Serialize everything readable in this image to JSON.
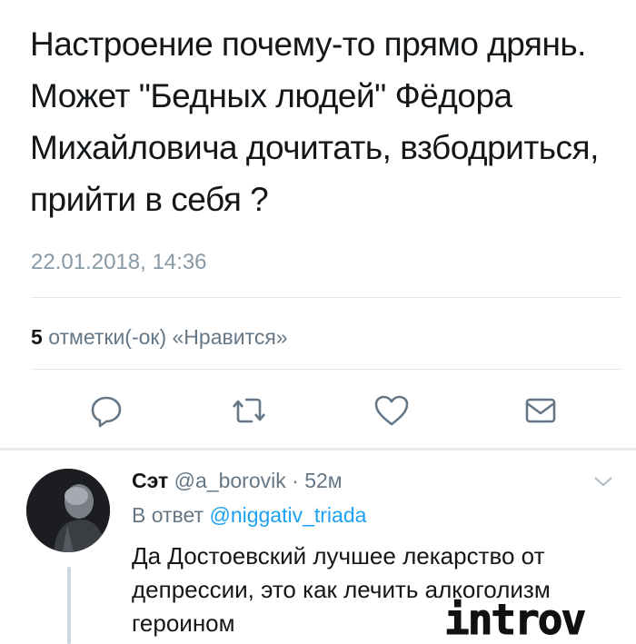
{
  "tweet": {
    "text": "Настроение почему-то прямо дрянь. Может \"Бедных людей\" Фёдора Михайловича дочитать, взбодриться, прийти в себя ?",
    "timestamp": "22.01.2018, 14:36",
    "likes_count": "5",
    "likes_label": "отметки(-ок) «Нравится»"
  },
  "actions": [
    "reply-icon",
    "retweet-icon",
    "like-icon",
    "message-icon"
  ],
  "reply": {
    "name": "Сэт",
    "handle": "@a_borovik",
    "separator": "·",
    "time": "52м",
    "reply_to_prefix": "В ответ",
    "reply_to_handle": "@niggativ_triada",
    "text": "Да Достоевский лучшее лекарство от депрессии, это как лечить алкоголизм героином"
  },
  "watermark": "introv",
  "colors": {
    "secondary": "#657786",
    "accent": "#1da1f2",
    "divider": "#e1e8ed"
  }
}
